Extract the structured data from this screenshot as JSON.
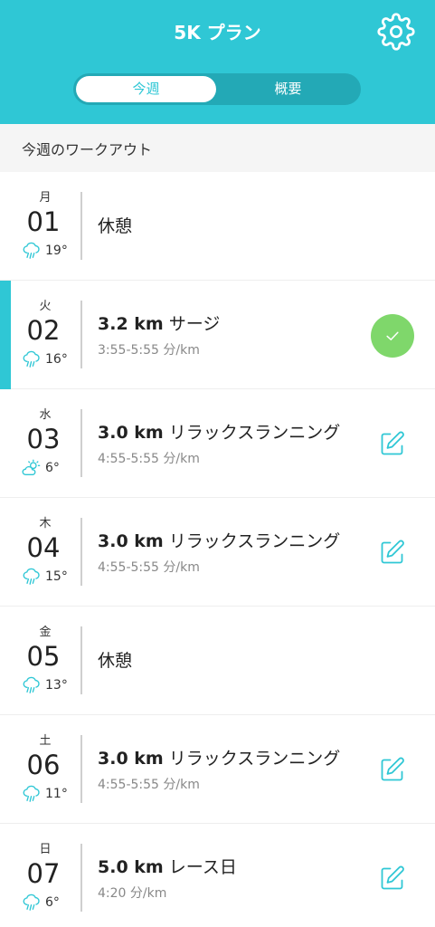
{
  "header": {
    "title": "5K プラン",
    "settings_icon": "gear-icon",
    "accent": "#2fc7d5"
  },
  "tabs": [
    {
      "label": "今週",
      "active": true
    },
    {
      "label": "概要",
      "active": false
    }
  ],
  "section_title": "今週のワークアウト",
  "days": [
    {
      "dow": "月",
      "day": "01",
      "weather_icon": "rain-icon",
      "temp": "19°",
      "kind": "rest",
      "title": "休憩"
    },
    {
      "dow": "火",
      "day": "02",
      "weather_icon": "rain-icon",
      "temp": "16°",
      "kind": "run",
      "distance": "3.2 km",
      "title": "サージ",
      "pace": "3:55-5:55 分/km",
      "status": "completed",
      "active": true
    },
    {
      "dow": "水",
      "day": "03",
      "weather_icon": "partly-cloudy-icon",
      "temp": "6°",
      "kind": "run",
      "distance": "3.0 km",
      "title": "リラックスランニング",
      "pace": "4:55-5:55 分/km",
      "status": "editable"
    },
    {
      "dow": "木",
      "day": "04",
      "weather_icon": "rain-icon",
      "temp": "15°",
      "kind": "run",
      "distance": "3.0 km",
      "title": "リラックスランニング",
      "pace": "4:55-5:55 分/km",
      "status": "editable"
    },
    {
      "dow": "金",
      "day": "05",
      "weather_icon": "rain-icon",
      "temp": "13°",
      "kind": "rest",
      "title": "休憩"
    },
    {
      "dow": "土",
      "day": "06",
      "weather_icon": "rain-icon",
      "temp": "11°",
      "kind": "run",
      "distance": "3.0 km",
      "title": "リラックスランニング",
      "pace": "4:55-5:55 分/km",
      "status": "editable"
    },
    {
      "dow": "日",
      "day": "07",
      "weather_icon": "rain-icon",
      "temp": "6°",
      "kind": "run",
      "distance": "5.0 km",
      "title": "レース日",
      "pace": "4:20 分/km",
      "status": "editable"
    }
  ]
}
